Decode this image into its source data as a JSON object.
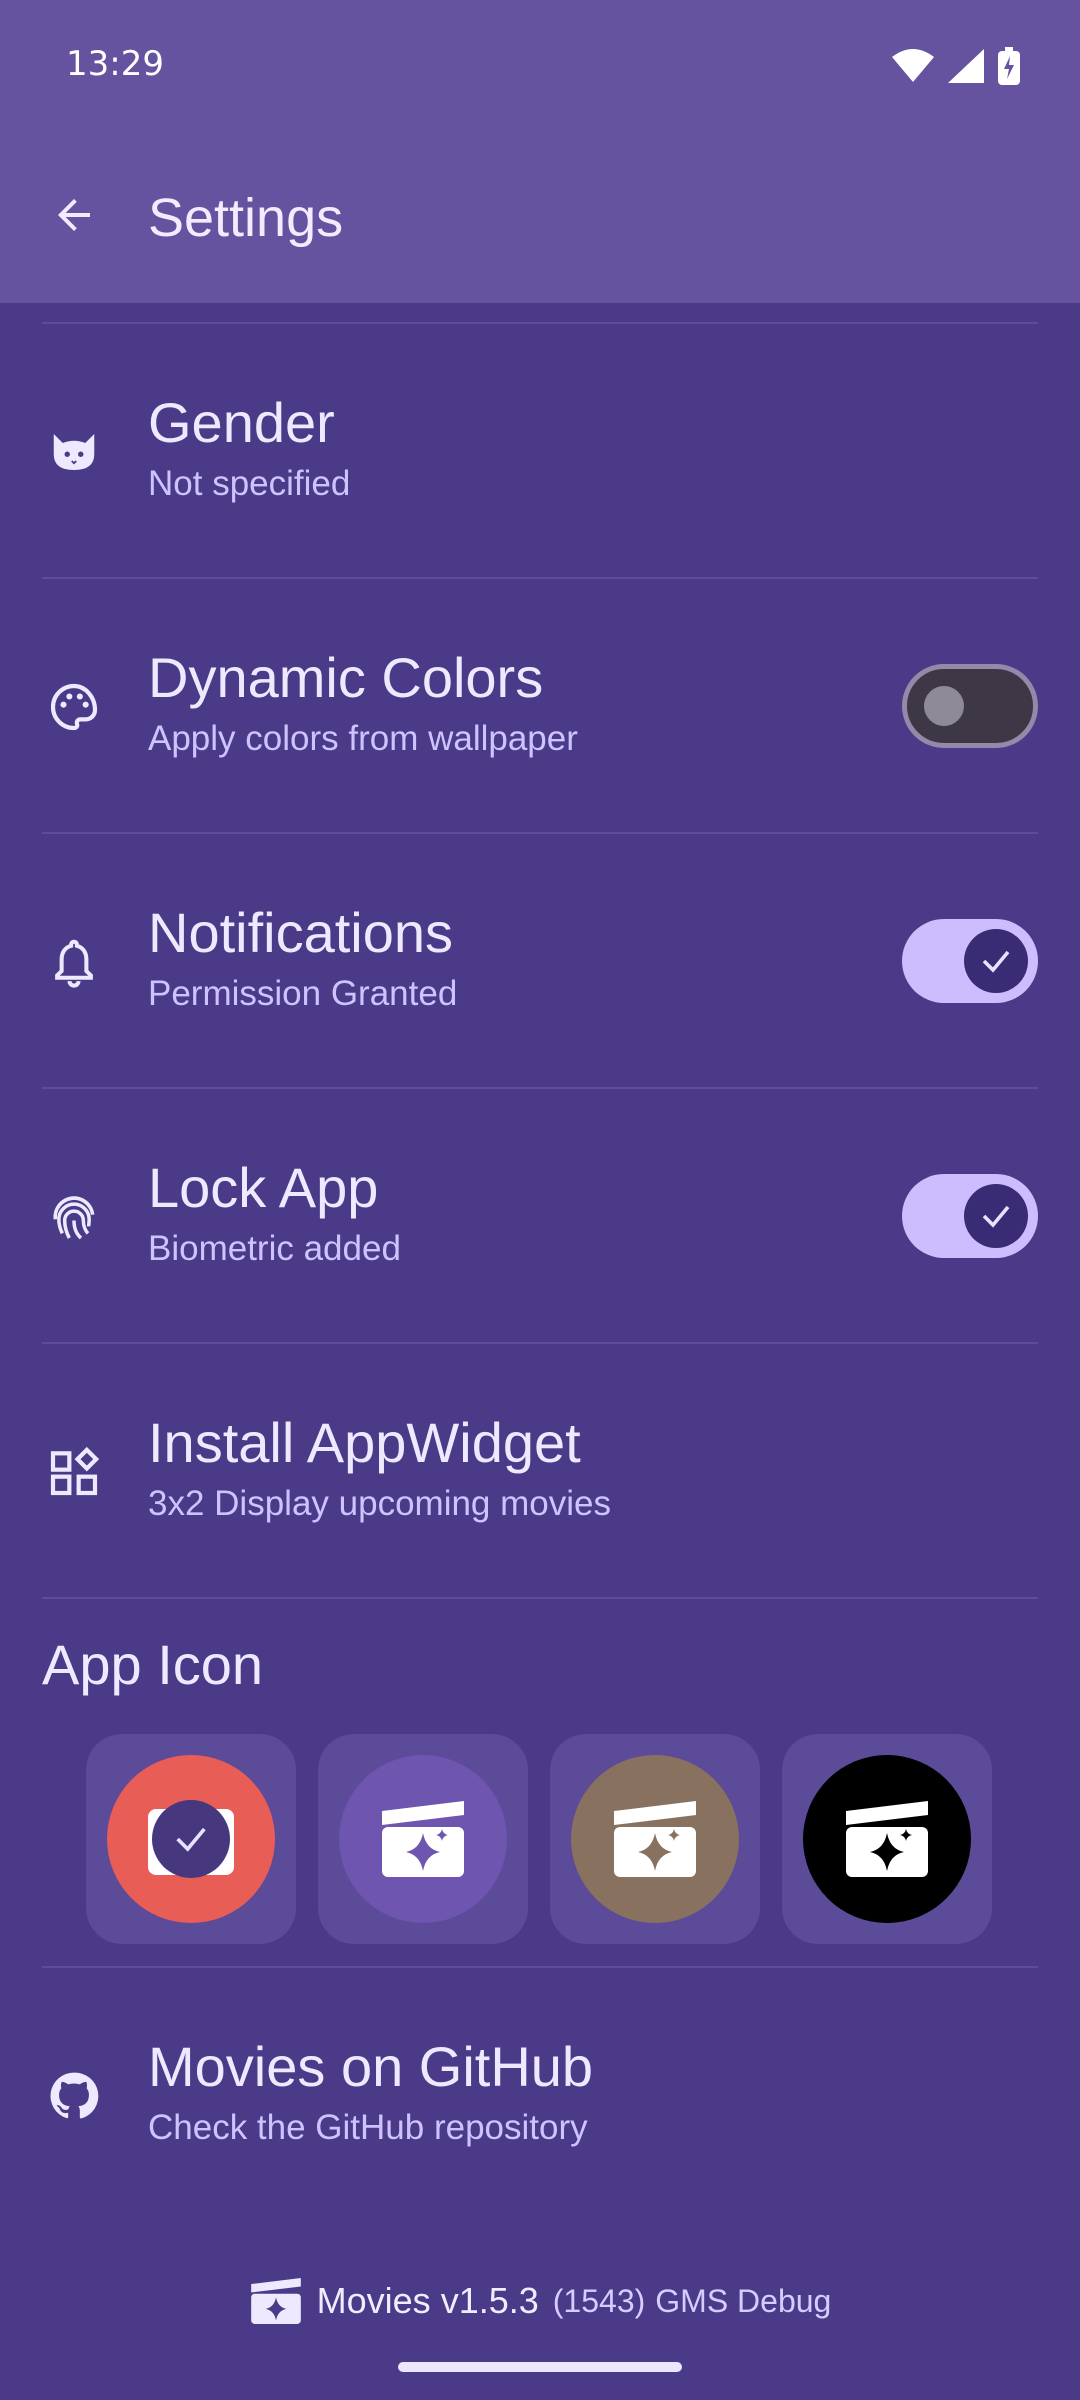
{
  "status_bar": {
    "time": "13:29"
  },
  "header": {
    "title": "Settings"
  },
  "settings": [
    {
      "id": "gender",
      "title": "Gender",
      "subtitle": "Not specified",
      "icon": "cat-icon"
    },
    {
      "id": "dynamic_colors",
      "title": "Dynamic Colors",
      "subtitle": "Apply colors from wallpaper",
      "icon": "palette-icon",
      "toggle": false
    },
    {
      "id": "notifications",
      "title": "Notifications",
      "subtitle": "Permission Granted",
      "icon": "bell-icon",
      "toggle": true
    },
    {
      "id": "lock_app",
      "title": "Lock App",
      "subtitle": "Biometric added",
      "icon": "fingerprint-icon",
      "toggle": true
    },
    {
      "id": "install_widget",
      "title": "Install AppWidget",
      "subtitle": "3x2 Display upcoming movies",
      "icon": "widgets-icon"
    },
    {
      "id": "github",
      "title": "Movies on GitHub",
      "subtitle": "Check the GitHub repository",
      "icon": "github-icon"
    }
  ],
  "app_icon_section": {
    "title": "App Icon",
    "options": [
      {
        "color": "#e85d55",
        "selected": true
      },
      {
        "color": "#6d55b0",
        "selected": false
      },
      {
        "color": "#88725f",
        "selected": false
      },
      {
        "color": "#000000",
        "selected": false
      }
    ]
  },
  "footer": {
    "app_name": "Movies v1.5.3",
    "build": "(1543)",
    "variant": "GMS Debug"
  },
  "colors": {
    "background": "#4a3a88",
    "topbar": "#65539f",
    "accent": "#cdbdff"
  }
}
